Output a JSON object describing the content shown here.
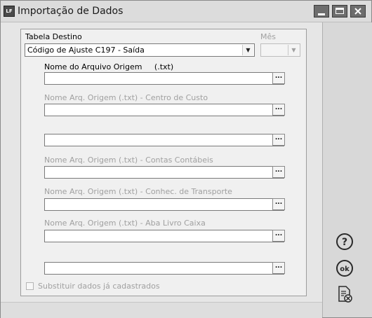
{
  "window": {
    "title": "Importação de Dados",
    "app_icon_text": "LF"
  },
  "form": {
    "tabela_destino": {
      "label": "Tabela Destino",
      "value": "Código de Ajuste C197 - Saída"
    },
    "mes": {
      "label": "Mês",
      "value": ""
    },
    "fields": [
      {
        "label": "Nome do Arquivo Origem     (.txt)",
        "value": "",
        "enabled": true
      },
      {
        "label": "Nome Arq. Origem (.txt) - Centro de Custo",
        "value": "",
        "enabled": false
      },
      {
        "label": "",
        "value": "",
        "enabled": true
      },
      {
        "label": "Nome Arq. Origem (.txt) - Contas Contábeis",
        "value": "",
        "enabled": false
      },
      {
        "label": "Nome Arq. Origem (.txt) - Conhec. de Transporte",
        "value": "",
        "enabled": false
      },
      {
        "label": "Nome Arq. Origem (.txt) - Aba Livro Caixa",
        "value": "",
        "enabled": false
      },
      {
        "label": "",
        "value": "",
        "enabled": true
      }
    ],
    "browse_label": "...",
    "substituir": {
      "label": "Substituir dados já cadastrados",
      "checked": false
    }
  },
  "sidebar": {
    "help_icon": "help-icon",
    "ok_icon": "ok-icon",
    "cancel_icon": "cancel-document-icon"
  }
}
